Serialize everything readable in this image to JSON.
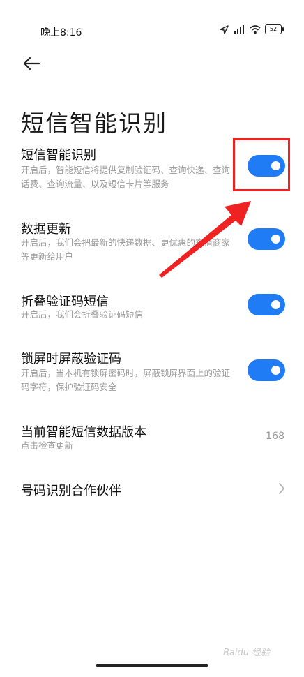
{
  "status_bar": {
    "time": "晚上8:16",
    "battery": "52",
    "icons": [
      "location-icon",
      "hd-signal-icon",
      "wifi-icon",
      "battery-icon"
    ]
  },
  "header": {
    "back_icon": "arrow-left-icon",
    "title": "短信智能识别"
  },
  "settings": [
    {
      "title": "短信智能识别",
      "desc": "开启后，智能短信将提供复制验证码、查询快递、查询话费、查询流量、以及短信卡片等服务",
      "toggle": true
    },
    {
      "title": "数据更新",
      "desc": "开启后，我们会把最新的快递数据、更优惠的充值商家等更新给用户",
      "toggle": true
    },
    {
      "title": "折叠验证码短信",
      "desc": "开启后，我们会折叠验证码短信",
      "toggle": true
    },
    {
      "title": "锁屏时屏蔽验证码",
      "desc": "开启后，当本机有锁屏密码时，屏蔽锁屏界面上的验证码字符，保护验证码安全",
      "toggle": true
    },
    {
      "title": "当前智能短信数据版本",
      "desc": "点击检查更新",
      "value": "168"
    },
    {
      "title": "号码识别合作伙伴",
      "chevron_icon": "chevron-right-icon"
    }
  ],
  "colors": {
    "accent": "#1f7cf5",
    "annotation": "#ee2222",
    "secondary_text": "#9a9a9a"
  },
  "watermark": "Baidu 经验"
}
